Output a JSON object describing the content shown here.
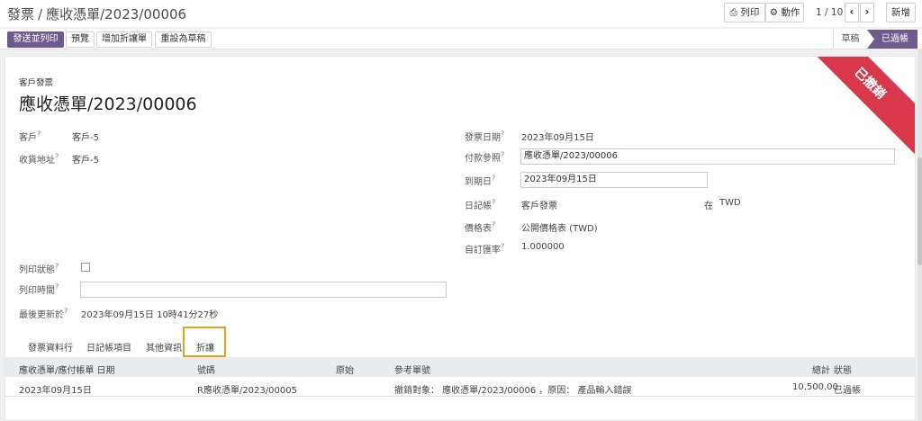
{
  "breadcrumb": {
    "parent": "發票",
    "separator": "/",
    "current": "應收憑單/2023/00006"
  },
  "toolbar": {
    "print_label": "列印",
    "action_label": "動作",
    "pager": "1 / 10",
    "new_label": "新增"
  },
  "actions": {
    "send_print": "發送並列印",
    "preview": "預覽",
    "add_credit_note": "增加折讓單",
    "reset_draft": "重設為草稿"
  },
  "statusbar": {
    "draft": "草稿",
    "posted": "已過帳"
  },
  "ribbon": {
    "text": "已撤銷"
  },
  "form": {
    "type_label": "客戶發票",
    "title": "應收憑單/2023/00006",
    "customer_label": "客戶",
    "customer_value": "客戶-5",
    "delivery_label": "收貨地址",
    "delivery_value": "客戶-5",
    "invoice_date_label": "發票日期",
    "invoice_date_value": "2023年09月15日",
    "payment_ref_label": "付款參照",
    "payment_ref_value": "應收憑單/2023/00006",
    "due_date_label": "到期日",
    "due_date_value": "2023年09月15日",
    "journal_label": "日記帳",
    "journal_value": "客戶發票",
    "journal_in": "在",
    "journal_currency": "TWD",
    "pricelist_label": "價格表",
    "pricelist_value": "公開價格表 (TWD)",
    "rate_label": "自訂匯率",
    "rate_value": "1.000000",
    "print_status_label": "列印狀態",
    "print_time_label": "列印時間",
    "print_time_value": "",
    "last_update_label": "最後更新於",
    "last_update_value": "2023年09月15日 10時41分27秒"
  },
  "tabs": [
    "發票資料行",
    "日記帳項目",
    "其他資訊",
    "折讓"
  ],
  "table": {
    "headers": [
      "應收憑單/應付帳單 日期",
      "號碼",
      "原始",
      "參考單號",
      "總計",
      "狀態"
    ],
    "rows": [
      [
        "2023年09月15日",
        "R應收憑單/2023/00005",
        "",
        "撤銷對象： 應收憑單/2023/00006 ，原因： 產品輸入錯誤",
        "10,500.00",
        "已過帳"
      ]
    ]
  }
}
